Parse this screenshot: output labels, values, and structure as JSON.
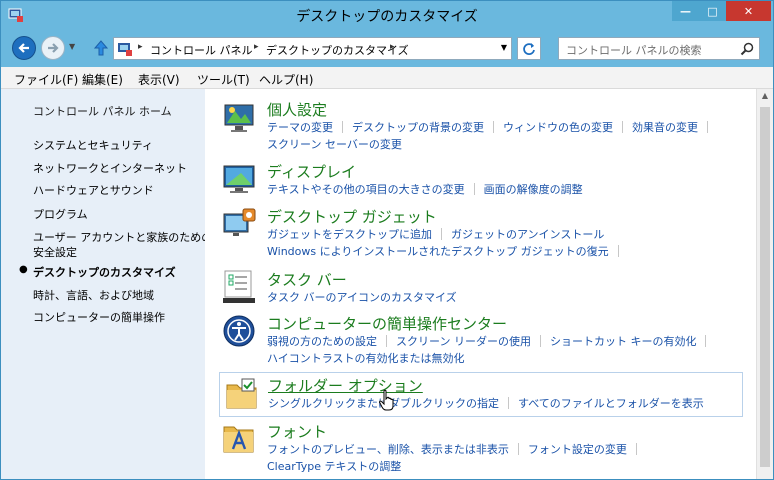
{
  "window": {
    "title": "デスクトップのカスタマイズ",
    "minimize_glyph": "—",
    "maximize_glyph": "□",
    "close_glyph": "✕"
  },
  "navigation": {
    "back_icon": "back-arrow-icon",
    "forward_icon": "forward-arrow-icon",
    "up_icon": "up-arrow-icon",
    "breadcrumb": [
      "コントロール パネル",
      "デスクトップのカスタマイズ"
    ],
    "breadcrumb_separator": "▸",
    "search_placeholder": "コントロール パネルの検索"
  },
  "menu": [
    "ファイル(F)",
    "編集(E)",
    "表示(V)",
    "ツール(T)",
    "ヘルプ(H)"
  ],
  "left_pane": {
    "home": "コントロール パネル ホーム",
    "items": [
      {
        "label": "システムとセキュリティ",
        "active": false
      },
      {
        "label": "ネットワークとインターネット",
        "active": false
      },
      {
        "label": "ハードウェアとサウンド",
        "active": false
      },
      {
        "label": "プログラム",
        "active": false
      },
      {
        "label": "ユーザー アカウントと家族のための",
        "active": false
      },
      {
        "label": "安全設定",
        "active": false
      },
      {
        "label": "デスクトップのカスタマイズ",
        "active": true
      },
      {
        "label": "時計、言語、および地域",
        "active": false
      },
      {
        "label": "コンピューターの簡単操作",
        "active": false
      }
    ]
  },
  "categories": [
    {
      "title": "個人設定",
      "icon": "personalization-icon",
      "links": [
        "テーマの変更",
        "デスクトップの背景の変更",
        "ウィンドウの色の変更",
        "効果音の変更",
        "スクリーン セーバーの変更"
      ]
    },
    {
      "title": "ディスプレイ",
      "icon": "display-icon",
      "links": [
        "テキストやその他の項目の大きさの変更",
        "画面の解像度の調整"
      ]
    },
    {
      "title": "デスクトップ ガジェット",
      "icon": "gadgets-icon",
      "links": [
        "ガジェットをデスクトップに追加",
        "ガジェットのアンインストール",
        "Windows によりインストールされたデスクトップ ガジェットの復元"
      ]
    },
    {
      "title": "タスク バー",
      "icon": "taskbar-icon",
      "links": [
        "タスク バーのアイコンのカスタマイズ"
      ]
    },
    {
      "title": "コンピューターの簡単操作センター",
      "icon": "ease-of-access-icon",
      "links": [
        "弱視の方のための設定",
        "スクリーン リーダーの使用",
        "ショートカット キーの有効化",
        "ハイコントラストの有効化または無効化"
      ]
    },
    {
      "title": "フォルダー オプション",
      "icon": "folder-options-icon",
      "links": [
        "シングルクリックまたはダブルクリックの指定",
        "すべてのファイルとフォルダーを表示"
      ]
    },
    {
      "title": "フォント",
      "icon": "fonts-icon",
      "links": [
        "フォントのプレビュー、削除、表示または非表示",
        "フォント設定の変更",
        "ClearType テキストの調整"
      ]
    }
  ],
  "colors": {
    "frame": "#6ab8de",
    "category_title": "#1b7c1e",
    "link": "#1a52a8",
    "close_button": "#c7372f",
    "left_pane": "#e7eff8"
  }
}
